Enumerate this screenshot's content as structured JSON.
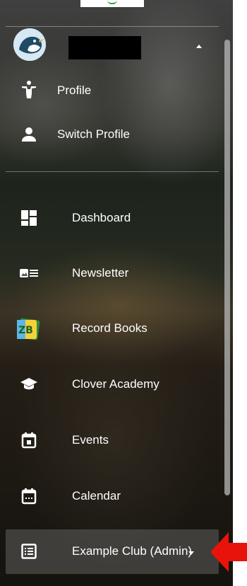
{
  "account": {
    "name_redacted": true,
    "menu_items": [
      {
        "label": "Profile",
        "icon": "person-walking-icon"
      },
      {
        "label": "Switch Profile",
        "icon": "person-icon"
      }
    ]
  },
  "nav": {
    "items": [
      {
        "label": "Dashboard",
        "icon": "dashboard-icon"
      },
      {
        "label": "Newsletter",
        "icon": "newsletter-icon"
      },
      {
        "label": "Record Books",
        "icon": "record-books-logo-icon"
      },
      {
        "label": "Clover Academy",
        "icon": "graduation-cap-icon"
      },
      {
        "label": "Events",
        "icon": "event-calendar-icon"
      },
      {
        "label": "Calendar",
        "icon": "calendar-icon"
      },
      {
        "label": "Example Club (Admin)",
        "icon": "list-icon",
        "selected": true
      }
    ]
  },
  "colors": {
    "text": "#ffffff",
    "selected_background": "#787878",
    "annotation_arrow": "#e8130b"
  },
  "annotation": {
    "icon": "red-arrow-icon",
    "points_to": "Example Club (Admin)"
  }
}
